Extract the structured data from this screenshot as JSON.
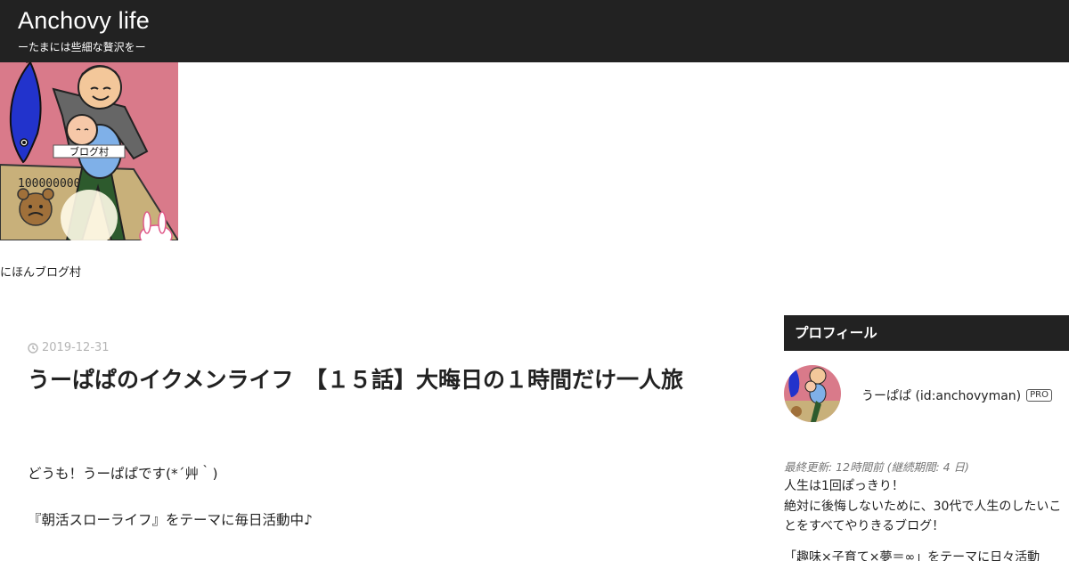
{
  "header": {
    "site_title": "Anchovy life",
    "site_description": "ーたまには些細な贅沢をー"
  },
  "banner": {
    "image_icon": "blog-mura-illustration-icon",
    "caption": "にほんブログ村",
    "image_label": "ブログ村",
    "money_text": "100000000"
  },
  "entry": {
    "date": "2019-12-31",
    "title": "うーぱぱのイクメンライフ　【１５話】大晦日の１時間だけ一人旅",
    "paragraphs": [
      "どうも！うーぱぱです(*´艸｀)",
      "『朝活スローライフ』をテーマに毎日活動中♪"
    ]
  },
  "sidebar": {
    "module_title": "プロフィール",
    "profile": {
      "name": "うーぱぱ (id:anchovyman)",
      "badge": "PRO",
      "updated": "最終更新: 12時間前 (継続期間: 4 日)",
      "line1": "人生は1回ぽっきり！",
      "line2": "絶対に後悔しないために、30代で人生のしたいことをすべてやりきるブログ！",
      "line3": "「趣味×子育て×夢＝∞」をテーマに日々活動中！！"
    }
  },
  "colors": {
    "header_bg": "#222222",
    "banner_pink": "#d97a8a",
    "fish_blue": "#2233cc",
    "date_gray": "#b5b5b5"
  }
}
